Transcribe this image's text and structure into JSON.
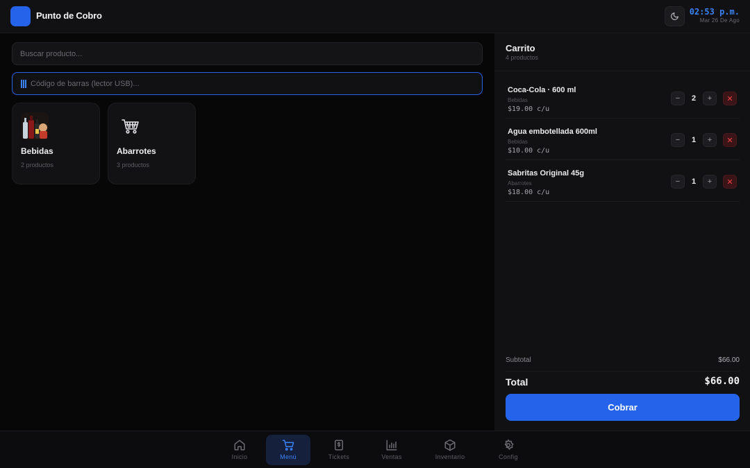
{
  "header": {
    "app_title": "Punto de Cobro",
    "time": "02:53 p.m.",
    "date": "Mar 26 De Ago",
    "theme_icon": "moon-icon"
  },
  "search": {
    "placeholder": "Buscar producto..."
  },
  "barcode": {
    "placeholder": "Código de barras (lector USB)..."
  },
  "categories": [
    {
      "name": "Bebidas",
      "count": "2 productos",
      "icon": "beverages-image"
    },
    {
      "name": "Abarrotes",
      "count": "3 productos",
      "icon": "shopping-cart-icon"
    }
  ],
  "cart": {
    "title": "Carrito",
    "subtitle": "4 productos",
    "items": [
      {
        "name": "Coca-Cola · 600 ml",
        "category": "Bebidas",
        "price": "$19.00 c/u",
        "qty": "2"
      },
      {
        "name": "Agua embotellada 600ml",
        "category": "Bebidas",
        "price": "$10.00 c/u",
        "qty": "1"
      },
      {
        "name": "Sabritas Original 45g",
        "category": "Abarrotes",
        "price": "$18.00 c/u",
        "qty": "1"
      }
    ],
    "minus_label": "−",
    "plus_label": "+",
    "remove_label": "✕",
    "subtotal_label": "Subtotal",
    "subtotal_value": "$66.00",
    "total_label": "Total",
    "total_value": "$66.00",
    "pay_label": "Cobrar"
  },
  "nav": [
    {
      "label": "Inicio",
      "icon": "home-icon",
      "active": false
    },
    {
      "label": "Menú",
      "icon": "cart-icon",
      "active": true
    },
    {
      "label": "Tickets",
      "icon": "receipt-icon",
      "active": false
    },
    {
      "label": "Ventas",
      "icon": "bar-chart-icon",
      "active": false
    },
    {
      "label": "Inventario",
      "icon": "box-icon",
      "active": false
    },
    {
      "label": "Config",
      "icon": "gear-icon",
      "active": false
    }
  ],
  "colors": {
    "accent": "#2563eb",
    "accent_text": "#3b82f6",
    "danger": "#ef4444",
    "background": "#070707",
    "panel": "#111113"
  }
}
